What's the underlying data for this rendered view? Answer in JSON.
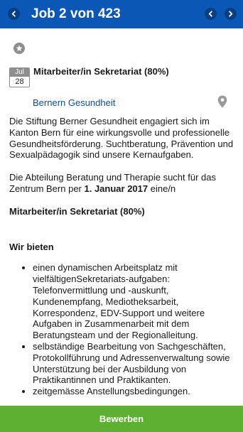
{
  "header": {
    "title": "Job 2 von 423",
    "back_icon": "chevron-left-icon",
    "prev_icon": "chevron-left-icon",
    "next_icon": "chevron-right-icon",
    "bar_color": "#0b57b5"
  },
  "job": {
    "favorite_icon": "star-icon",
    "date_month": "Jul",
    "date_day": "28",
    "title": "Mitarbeiter/in Sekretariat (80%)",
    "company": "Bernern Gesundheit",
    "location_icon": "map-pin-icon"
  },
  "body": {
    "intro": "Die Stiftung Berner Gesundheit engagiert sich im Kanton Bern für eine wirkungsvolle und professionelle Gesundheitsförderung. Suchtberatung, Prävention und Sexualpädagogik sind unsere Kernaufgaben.",
    "search_prefix": "Die Abteilung Beratung und Therapie sucht für das Zentrum Bern per ",
    "search_date": "1. Januar 2017",
    "search_suffix": " eine/n",
    "position": "Mitarbeiter/in Sekretariat (80%)",
    "section_title": "Wir bieten",
    "offers": [
      "einen dynamischen Arbeitsplatz mit vielfältigenSekretariats-aufgaben: Telefonvermittlung und -auskunft, Kundenempfang, Mediotheksarbeit, Korrespondenz, EDV-Support und weitere Aufgaben in Zusammenarbeit mit dem Beratungsteam und der Regionalleitung.",
      "selbständige Bearbeitung von Sachgeschäften, Protokollführung und Adressenverwaltung sowie Unterstützung bei der Ausbildung von Praktikantinnen und Praktikanten.",
      "zeitgemässe Anstellungsbedingungen."
    ]
  },
  "footer": {
    "apply_label": "Bewerben",
    "apply_color": "#5db130"
  }
}
